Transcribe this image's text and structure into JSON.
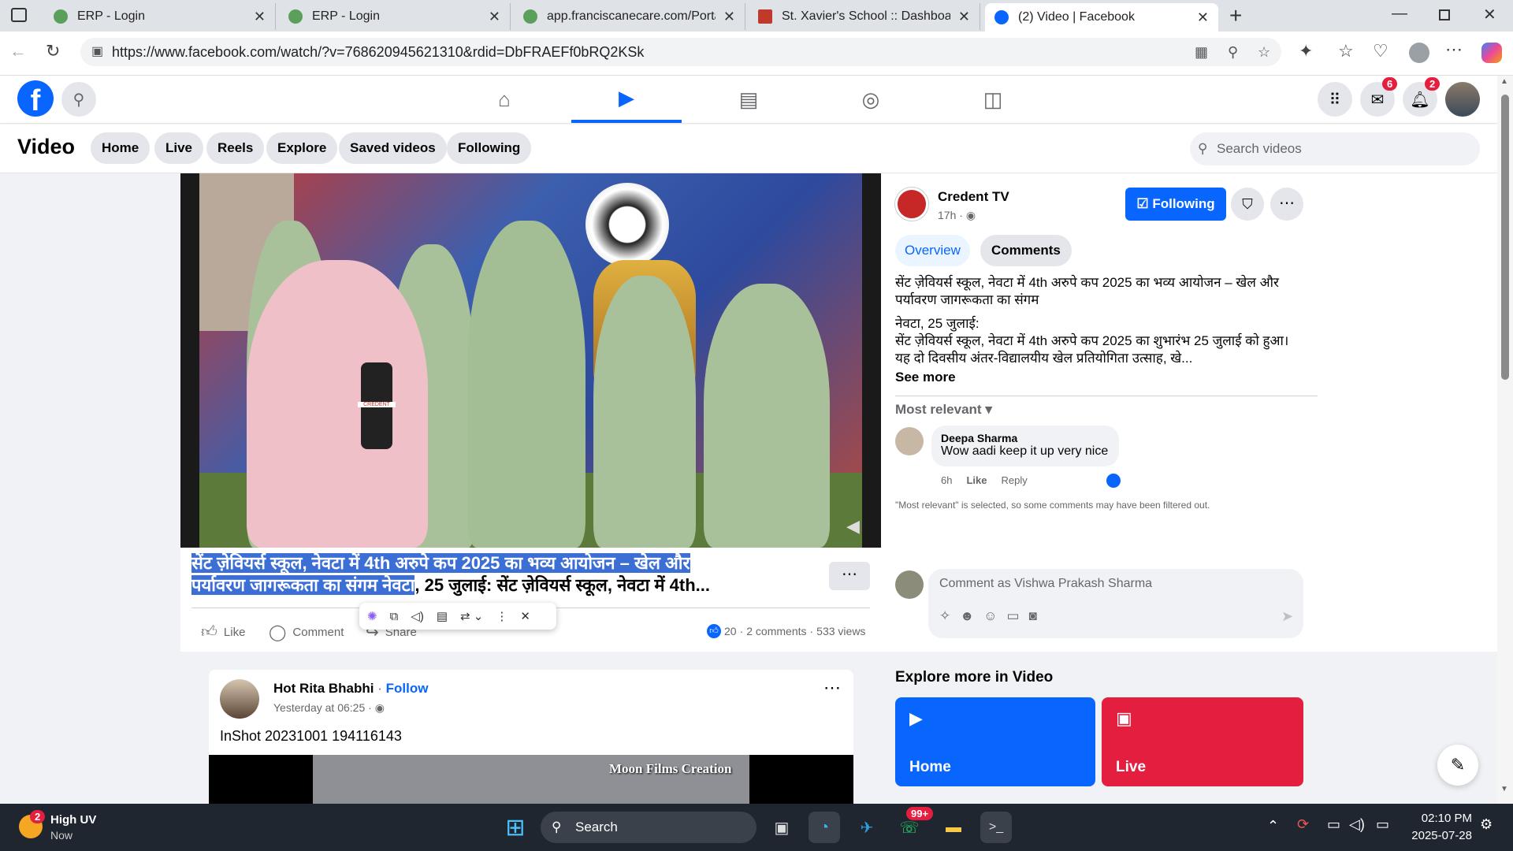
{
  "browser": {
    "tabs": [
      {
        "title": "ERP - Login",
        "fav_color": "#5aa05a"
      },
      {
        "title": "ERP - Login",
        "fav_color": "#5aa05a"
      },
      {
        "title": "app.franciscanecare.com/Portal/D",
        "fav_color": "#5aa05a"
      },
      {
        "title": "St. Xavier's School :: Dashboard",
        "fav_color": "#c0392b"
      },
      {
        "title": "(2) Video | Facebook",
        "fav_color": "#0866ff"
      }
    ],
    "url": "https://www.facebook.com/watch/?v=768620945621310&rdid=DbFRAEFf0bRQ2KSk"
  },
  "fb_nav": {
    "messenger_badge": "6",
    "notifications_badge": "2"
  },
  "video_header": {
    "title": "Video",
    "pills": [
      "Home",
      "Live",
      "Reels",
      "Explore",
      "Saved videos",
      "Following"
    ],
    "search_placeholder": "Search videos"
  },
  "post": {
    "title_highlighted_1": "सेंट ज़ेवियर्स स्कूल, नेवटा में 4th अरुपे कप 2025 का भव्य आयोजन – खेल और",
    "title_highlighted_2": "पर्यावरण जागरूकता का संगम नेवटा",
    "title_rest": ", 25 जुलाई: सेंट ज़ेवियर्स स्कूल, नेवटा में 4th...",
    "like": "Like",
    "comment": "Comment",
    "share": "Share",
    "reactions": "20",
    "comments_count": "2 comments",
    "views": "533 views",
    "mic_label": "CREDENT"
  },
  "sidebar": {
    "page_name": "Credent TV",
    "time": "17h ·",
    "following_btn": "Following",
    "tabs": [
      "Overview",
      "Comments"
    ],
    "desc_1": "सेंट ज़ेवियर्स स्कूल, नेवटा में 4th अरुपे कप 2025 का भव्य आयोजन – खेल और पर्यावरण जागरूकता का संगम",
    "desc_2": "नेवटा, 25 जुलाई:",
    "desc_3": "सेंट ज़ेवियर्स स्कूल, नेवटा में 4th अरुपे कप 2025 का शुभारंभ 25 जुलाई को हुआ। यह दो दिवसीय अंतर-विद्यालयीय खेल प्रतियोगिता उत्साह, खे...",
    "see_more": "See more",
    "sort": "Most relevant",
    "comment": {
      "author": "Deepa Sharma",
      "text": "Wow aadi keep it up very nice",
      "time": "6h",
      "like": "Like",
      "reply": "Reply"
    },
    "filter_note": "\"Most relevant\" is selected, so some comments may have been filtered out.",
    "comment_placeholder": "Comment as Vishwa Prakash Sharma",
    "explore_title": "Explore more in Video",
    "explore_cards": [
      {
        "label": "Home",
        "color": "#0866ff"
      },
      {
        "label": "Live",
        "color": "#e41e3f"
      }
    ]
  },
  "feed_post": {
    "author": "Hot Rita Bhabhi",
    "follow": "Follow",
    "time": "Yesterday at 06:25 ·",
    "caption": "InShot 20231001 194116143",
    "overlay": "Moon Films Creation"
  },
  "taskbar": {
    "weather_title": "High UV",
    "weather_sub": "Now",
    "weather_badge": "2",
    "search": "Search",
    "whatsapp_badge": "99+",
    "time": "02:10 PM",
    "date": "2025-07-28"
  }
}
